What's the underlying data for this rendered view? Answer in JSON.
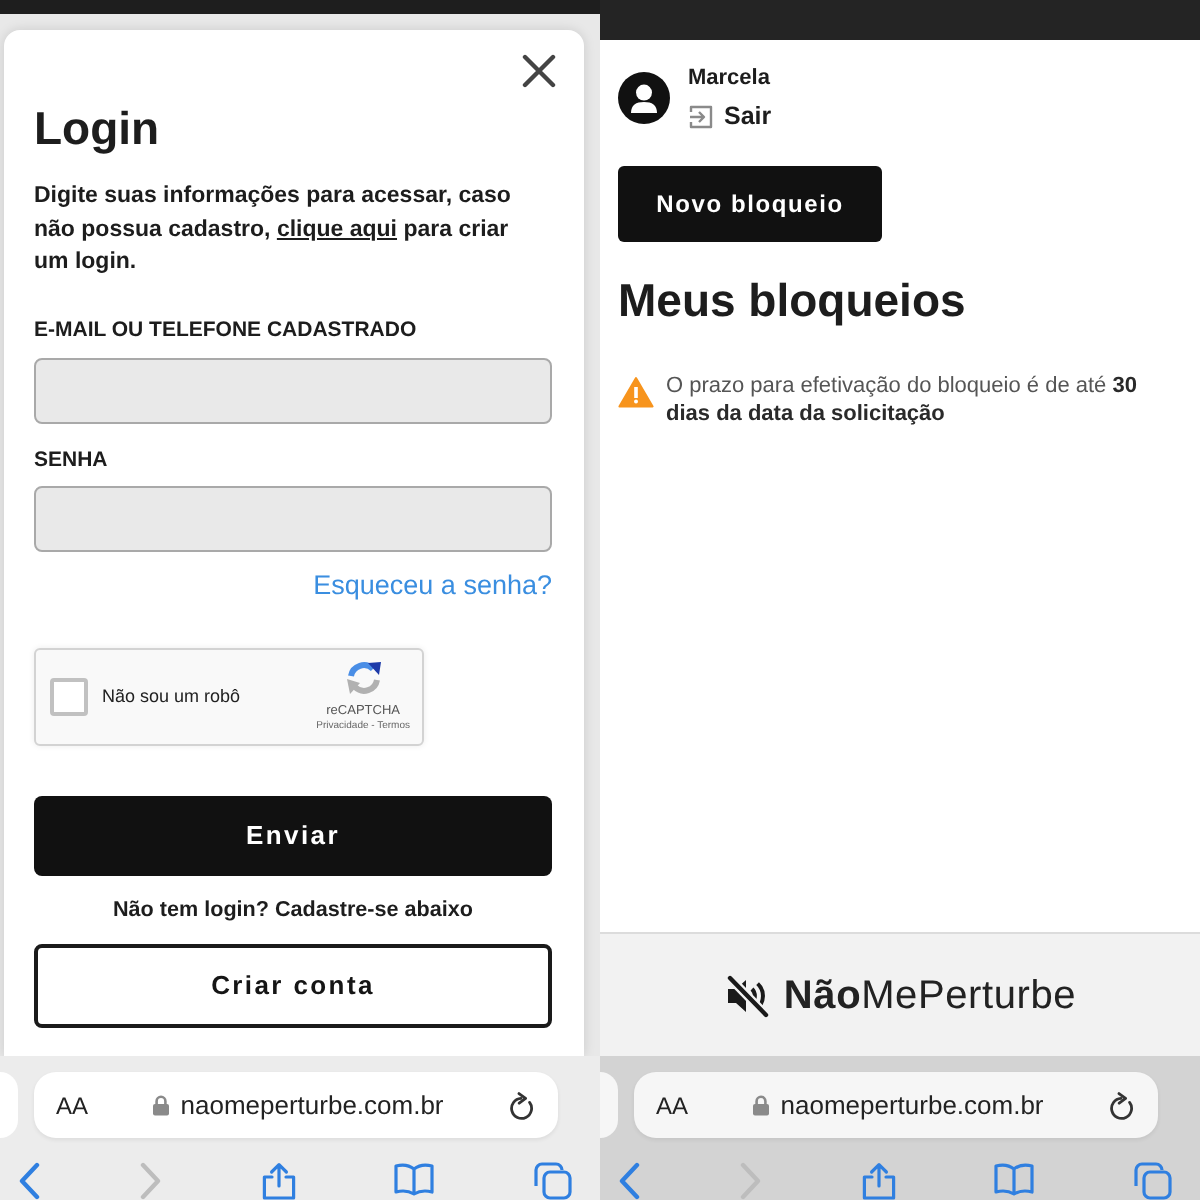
{
  "login_screen": {
    "modal": {
      "title": "Login",
      "intro": {
        "text": "Digite suas informações para acessar, caso não possua cadastro,",
        "link": "clique aqui",
        "text_end": "para criar um login."
      },
      "fields": [
        {
          "label": "E-MAIL OU TELEFONE CADASTRADO"
        },
        {
          "label": "SENHA"
        }
      ],
      "forgot_link": "Esqueceu a senha?",
      "captcha": {
        "label": "Não sou um robô",
        "checked": false,
        "brand": "reCAPTCHA",
        "terms": "Privacidade - Termos"
      },
      "submit_button": "Enviar",
      "signup_prompt": "Não tem login? Cadastre-se abaixo",
      "signup_button": "Criar conta"
    },
    "browser": {
      "text_size_button": "AA",
      "url": "naomeperturbe.com.br",
      "toolbar": [
        {
          "kind": "back",
          "disabled": false
        },
        {
          "kind": "forward",
          "disabled": true
        },
        {
          "kind": "share",
          "disabled": false
        },
        {
          "kind": "bookmarks",
          "disabled": false
        },
        {
          "kind": "tabs",
          "disabled": false
        }
      ]
    }
  },
  "blocks_screen": {
    "user": {
      "name": "Marcela",
      "logout": "Sair"
    },
    "new_button": "Novo bloqueio",
    "title": "Meus bloqueios",
    "notice": "O prazo para efetivação do bloqueio é de até **30 dias da data da solicitação**",
    "footer": {
      "logo": "**Não**MePerturbe"
    },
    "browser": {
      "text_size_button": "AA",
      "url": "naomeperturbe.com.br",
      "toolbar": [
        {
          "kind": "back",
          "disabled": false
        },
        {
          "kind": "forward",
          "disabled": true
        },
        {
          "kind": "share",
          "disabled": false
        },
        {
          "kind": "bookmarks",
          "disabled": false
        },
        {
          "kind": "tabs",
          "disabled": false
        }
      ]
    }
  }
}
